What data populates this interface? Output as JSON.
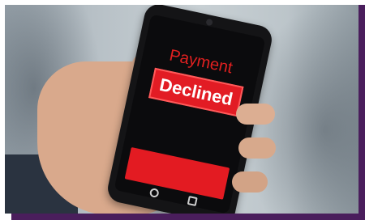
{
  "screen": {
    "title": "Payment",
    "badge": "Declined"
  },
  "colors": {
    "accent": "#e21c24",
    "frame_shadow": "#4a1e5c"
  },
  "icons": {
    "home": "home-circle-icon",
    "recents": "recents-square-icon"
  }
}
